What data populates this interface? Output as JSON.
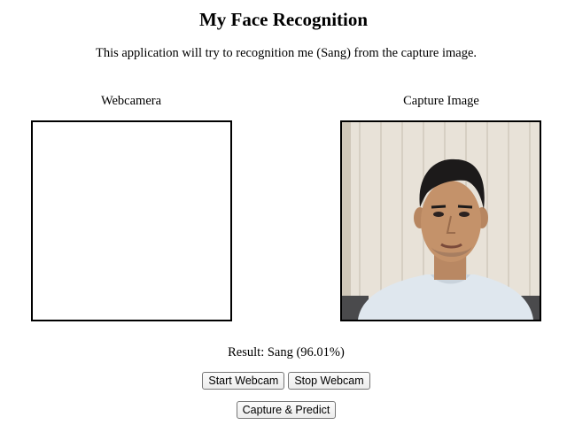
{
  "header": {
    "title": "My Face Recognition",
    "description": "This application will try to recognition me (Sang) from the capture image."
  },
  "webcam": {
    "label": "Webcamera"
  },
  "capture": {
    "label": "Capture Image",
    "image_icon": "captured-face-photo"
  },
  "result": {
    "text": "Result: Sang (96.01%)"
  },
  "buttons": {
    "start_webcam": "Start Webcam",
    "stop_webcam": "Stop Webcam",
    "capture_predict": "Capture & Predict"
  }
}
